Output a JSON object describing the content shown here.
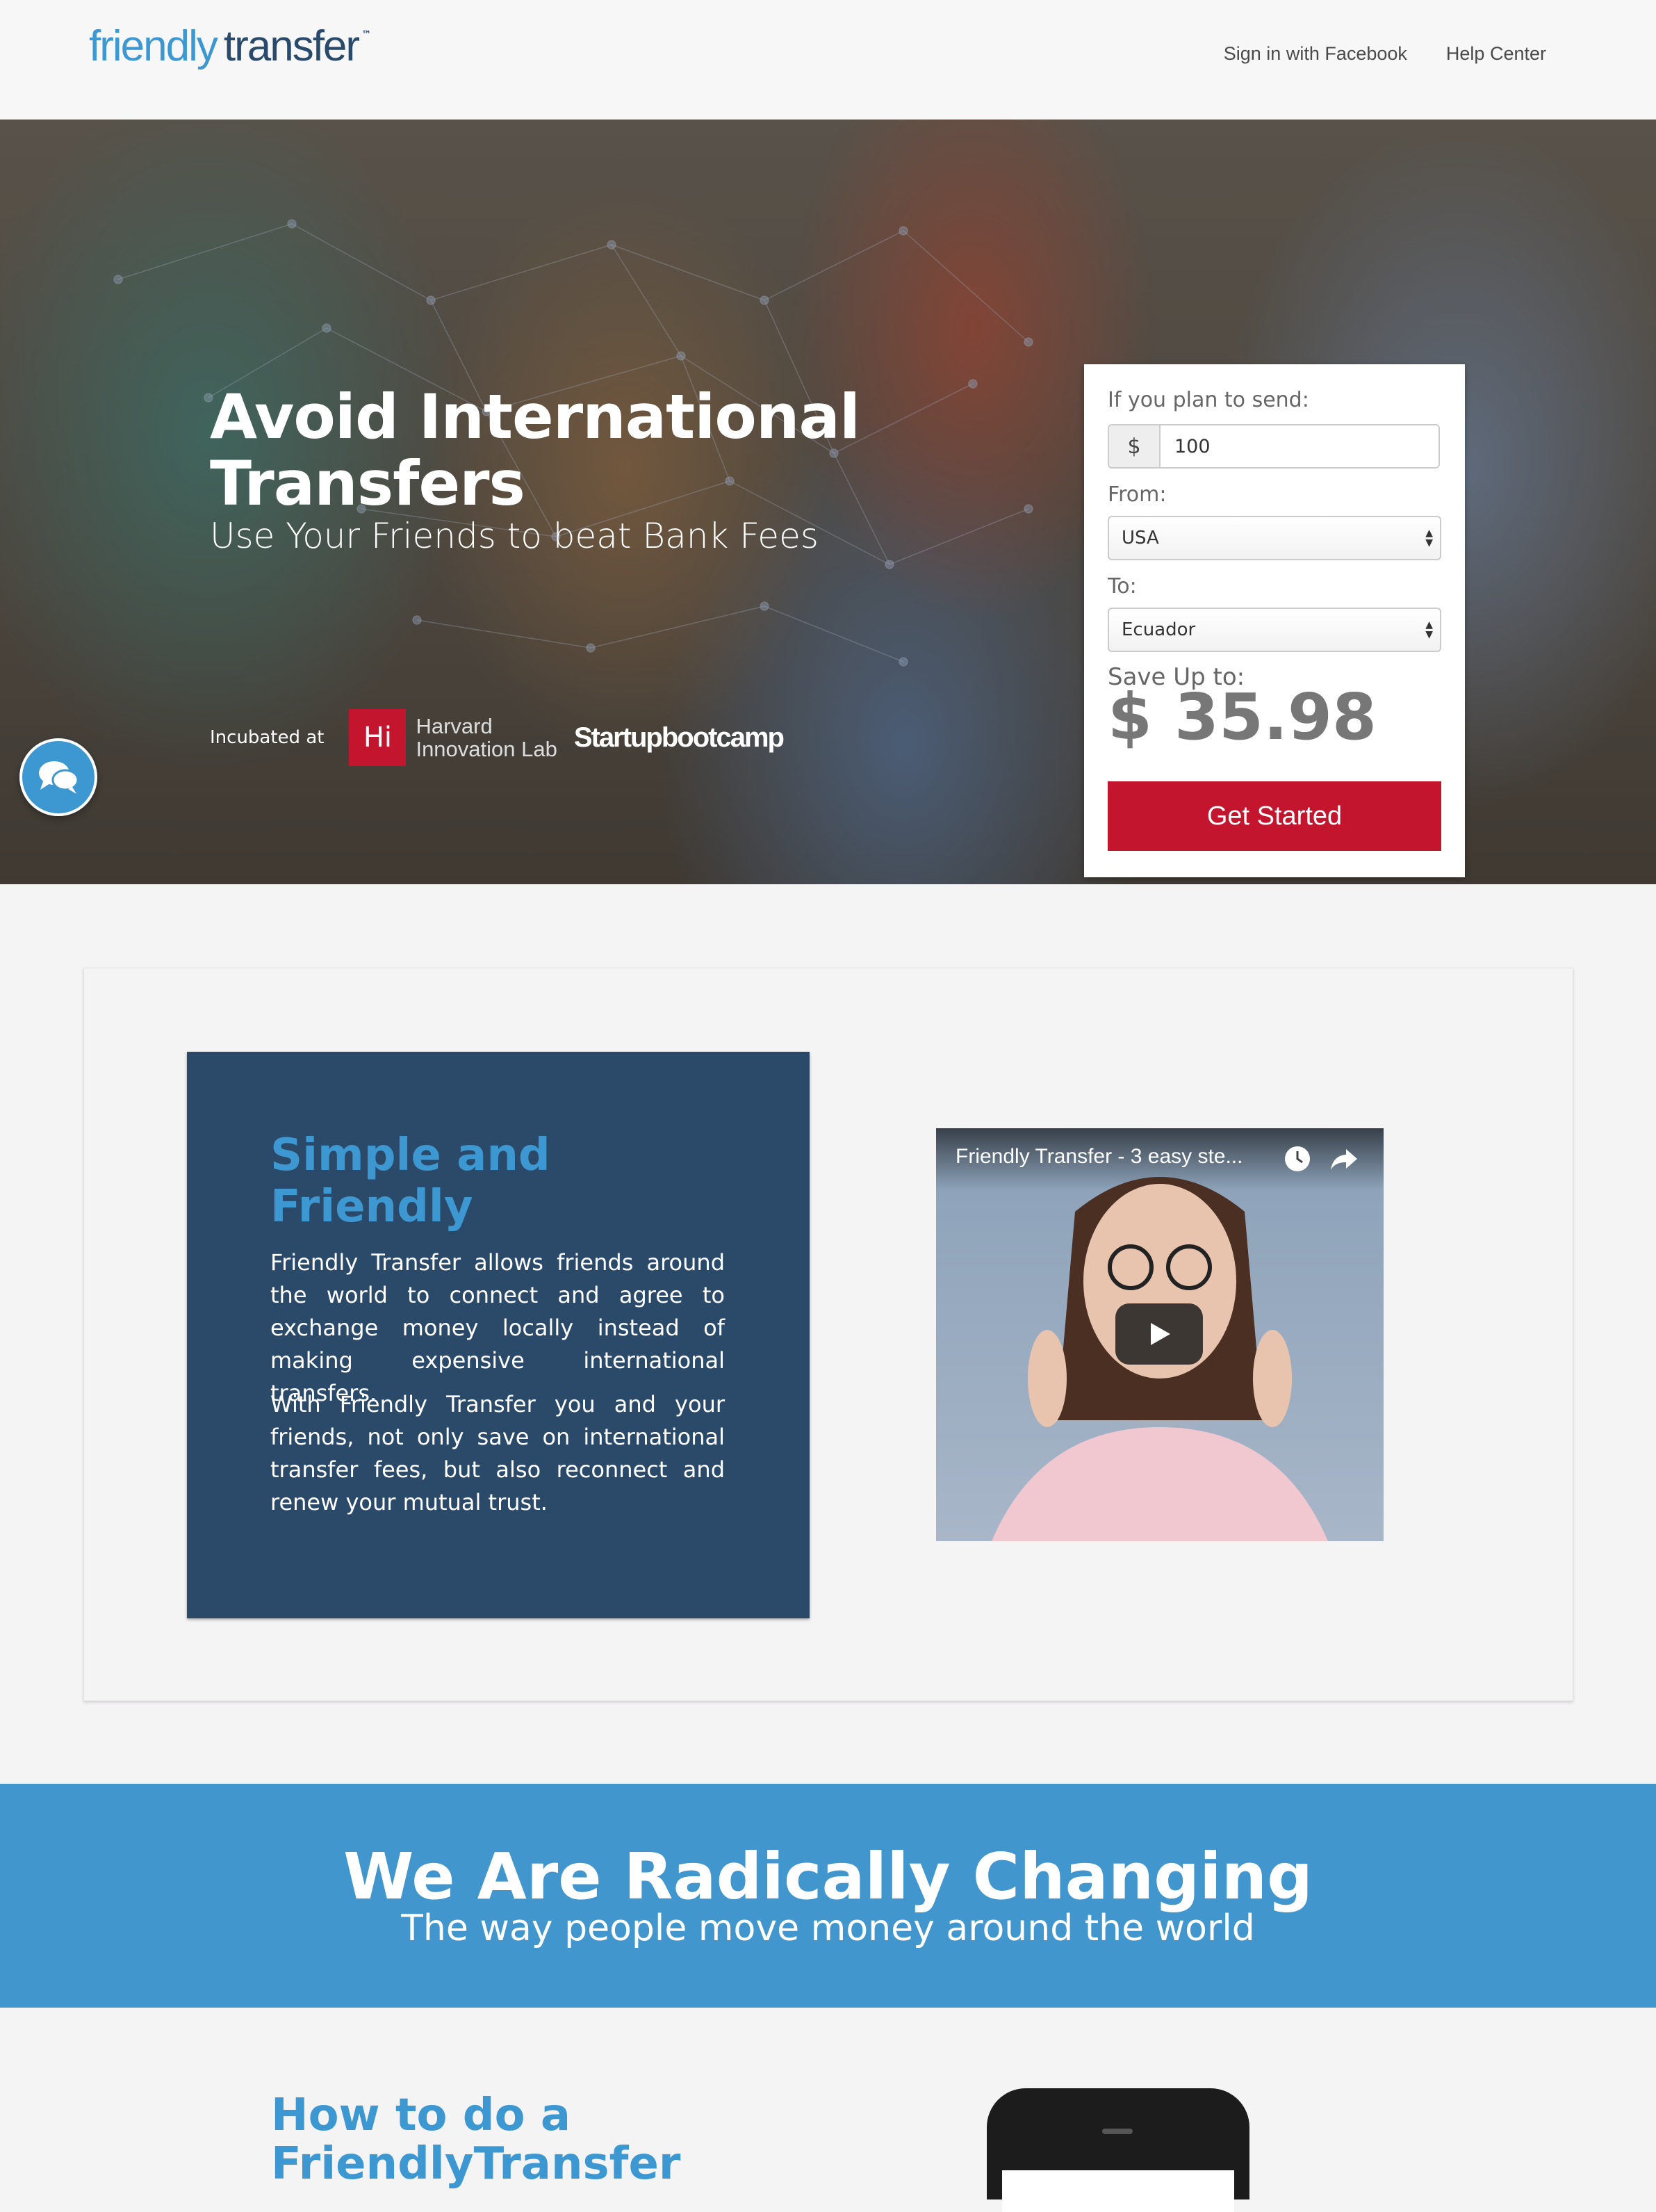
{
  "header": {
    "logo_word1": "friendly",
    "logo_word2": "transfer",
    "logo_tm": "™",
    "nav": [
      "Sign in with Facebook",
      "Help Center"
    ]
  },
  "hero": {
    "title": "Avoid International Transfers",
    "subtitle": "Use Your Friends to beat Bank Fees",
    "incubated_label": "Incubated at",
    "hi_logo": "Hi",
    "harvard_line1": "Harvard",
    "harvard_line2": "Innovation Lab",
    "startupbootcamp": "Startupbootcamp"
  },
  "form": {
    "send_label": "If you plan to send:",
    "currency_symbol": "$",
    "amount": "100",
    "from_label": "From:",
    "from_value": "USA",
    "to_label": "To:",
    "to_value": "Ecuador",
    "save_label": "Save Up to:",
    "save_value": "$ 35.98",
    "cta": "Get Started"
  },
  "intro": {
    "heading": "Simple and Friendly",
    "p1": "Friendly Transfer allows friends around the world to connect and agree to exchange money locally instead of making expensive international transfers.",
    "p2": "With Friendly Transfer you and your friends, not only save on international transfer fees, but also reconnect and renew your mutual trust.",
    "video_title": "Friendly Transfer - 3 easy ste..."
  },
  "banner": {
    "title": "We Are Radically Changing",
    "subtitle": "The way people move money around the world"
  },
  "howto": {
    "title": "How to do a FriendlyTransfer"
  },
  "colors": {
    "brand_blue": "#3d97d1",
    "navy": "#2b4a6a",
    "cta_red": "#c4152e",
    "banner_blue": "#4196cd"
  }
}
